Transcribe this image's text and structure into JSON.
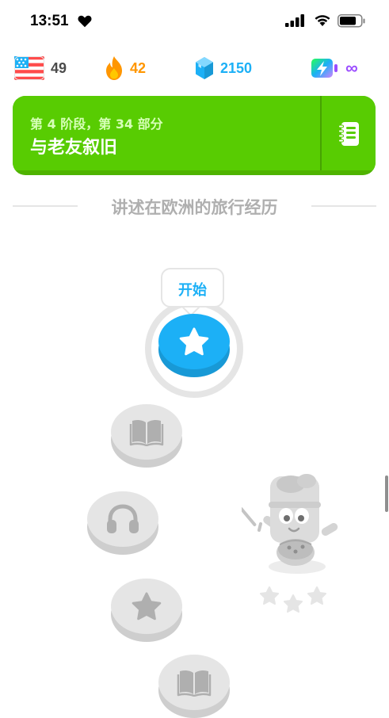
{
  "status_bar": {
    "time": "13:51"
  },
  "stats": {
    "language_flag": "us-flag-icon",
    "language_count": "49",
    "streak": "42",
    "gems": "2150",
    "energy": "∞"
  },
  "unit": {
    "subtitle": "第 4 阶段，第 34 部分",
    "title": "与老友叙旧"
  },
  "section": {
    "title": "讲述在欧洲的旅行经历"
  },
  "path": {
    "start_label": "开始",
    "nodes": [
      {
        "icon": "star-icon",
        "state": "active"
      },
      {
        "icon": "book-icon",
        "state": "locked"
      },
      {
        "icon": "headphones-icon",
        "state": "locked"
      },
      {
        "icon": "star-icon",
        "state": "locked"
      },
      {
        "icon": "book-icon",
        "state": "locked"
      }
    ]
  },
  "colors": {
    "green": "#58cc02",
    "green_dark": "#46a302",
    "blue": "#1cb0f6",
    "orange": "#ff9600",
    "gray": "#afafaf",
    "purple": "#9b4dff"
  }
}
